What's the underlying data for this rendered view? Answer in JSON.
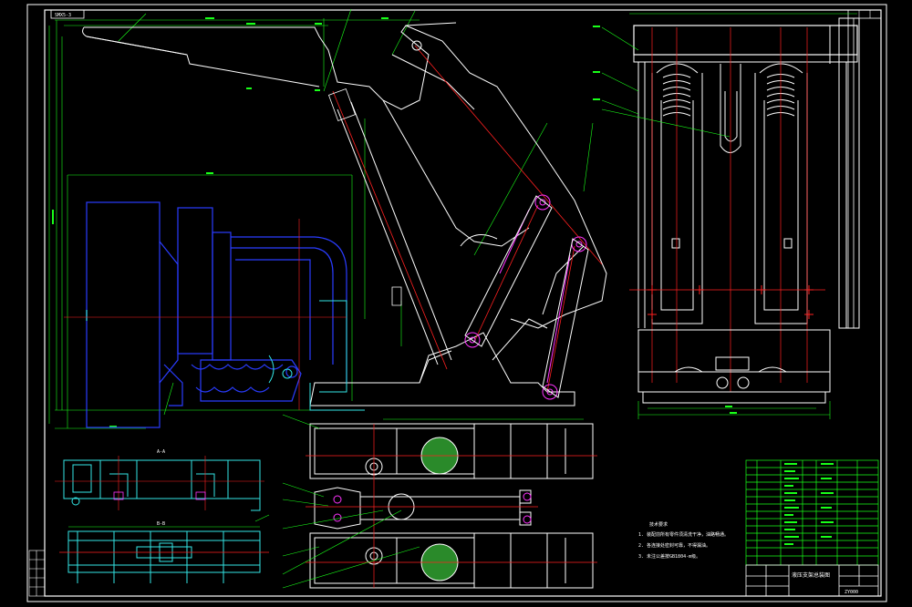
{
  "drawing": {
    "corner_label": "SMX5-3",
    "view_labels": [
      "A-A",
      "B-B"
    ],
    "notes": {
      "heading": "技术要求",
      "line1": "1. 装配前所有零件须清洗干净，油路畅通。",
      "line2": "2. 各连接处密封可靠，不得漏油。",
      "line3": "3. 未注公差按GB1804-m级。"
    },
    "title_block": {
      "name": "液压支架总装图",
      "drawing_no": "ZY000"
    },
    "colors": {
      "background": "#000000",
      "outline": "#ffffff",
      "dimension": "#19ff19",
      "centerline": "#ff2020",
      "hidden_blue": "#2a3cff",
      "magenta": "#ff33ff",
      "cyan": "#33e6e6"
    }
  }
}
